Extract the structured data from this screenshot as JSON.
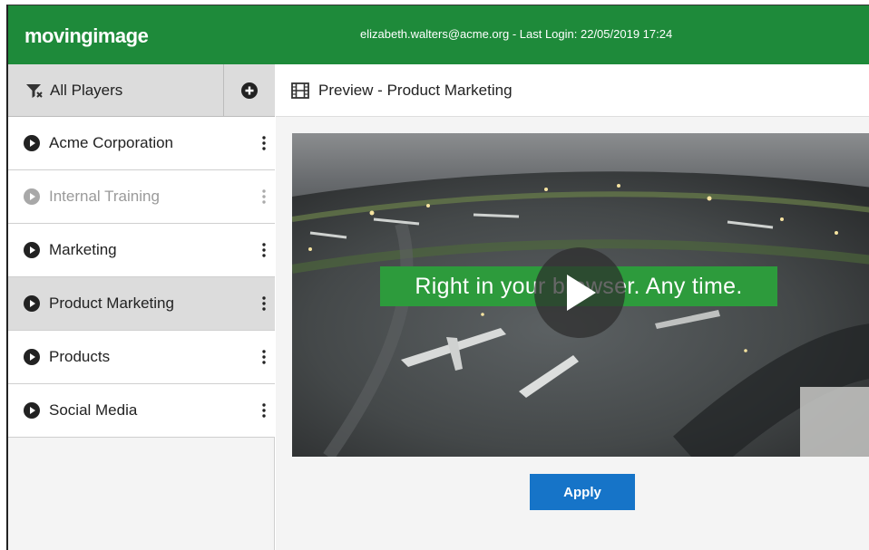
{
  "header": {
    "logo_text": "movingimage",
    "user_info": "elizabeth.walters@acme.org - Last Login: 22/05/2019 17:24"
  },
  "sidebar": {
    "title": "All Players",
    "items": [
      {
        "label": "Acme Corporation",
        "state": "normal"
      },
      {
        "label": "Internal Training",
        "state": "disabled"
      },
      {
        "label": "Marketing",
        "state": "normal"
      },
      {
        "label": "Product Marketing",
        "state": "selected"
      },
      {
        "label": "Products",
        "state": "normal"
      },
      {
        "label": "Social Media",
        "state": "normal"
      }
    ]
  },
  "main": {
    "title": "Preview - Product Marketing",
    "video_caption": "Right in your browser. Any time.",
    "apply_label": "Apply"
  },
  "colors": {
    "brand_green": "#1e8a3a",
    "caption_green": "#2d9b3c",
    "button_blue": "#1674c8"
  },
  "icons": {
    "sidebar_filter": "filter-icon",
    "sidebar_add": "plus-circle-icon",
    "item_play": "play-circle-icon",
    "item_menu": "kebab-menu-icon",
    "preview": "film-icon",
    "video_play": "play-icon"
  }
}
